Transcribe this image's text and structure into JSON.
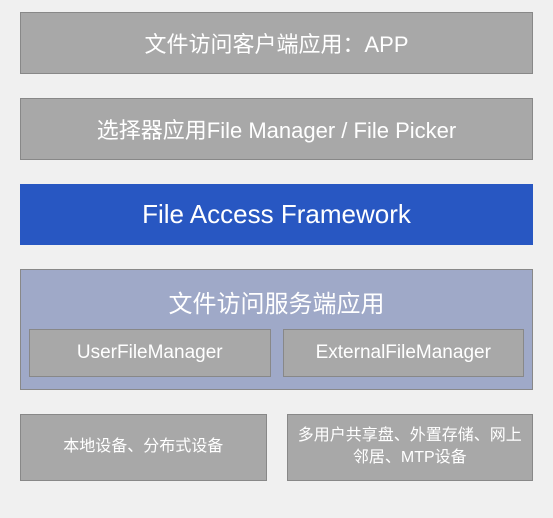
{
  "layers": {
    "app": "文件访问客户端应用：APP",
    "picker": "选择器应用File Manager / File Picker",
    "framework": "File Access Framework",
    "server": {
      "title": "文件访问服务端应用",
      "modules": [
        "UserFileManager",
        "ExternalFileManager"
      ]
    },
    "storage": [
      "本地设备、分布式设备",
      "多用户共享盘、外置存储、网上邻居、MTP设备"
    ]
  }
}
